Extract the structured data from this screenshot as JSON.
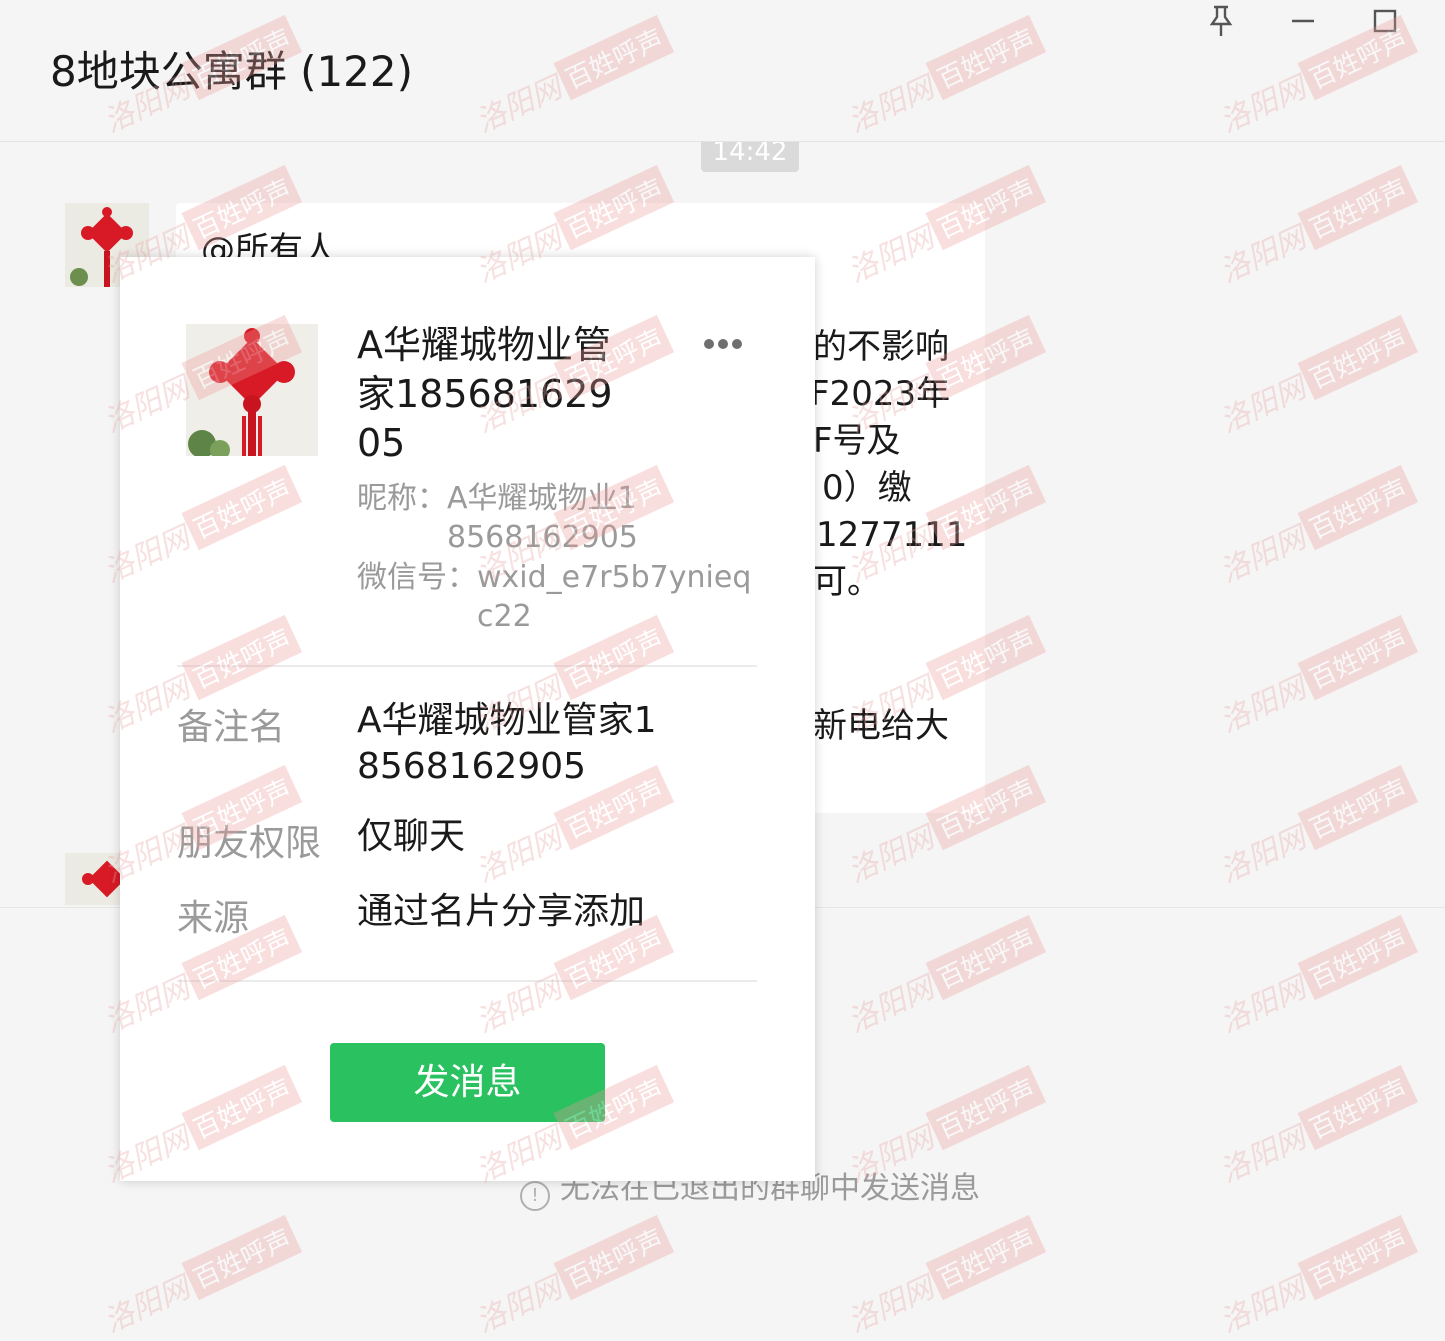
{
  "window": {
    "title": "8地块公寓群 (122)",
    "controls": {
      "pin": "pin-icon",
      "minimize": "minimize-icon",
      "maximize": "maximize-icon"
    }
  },
  "chat": {
    "time": "14:42",
    "message_lines": [
      "@所有人",
      "的不影响",
      "F2023年",
      "F号及",
      "0）缴",
      "1277111",
      "可。",
      "新电给大"
    ],
    "notice": "无法在已退出的群聊中发送消息"
  },
  "profile_card": {
    "name": "A华耀城物业管家18568162905",
    "nickname_label": "昵称：",
    "nickname": "A华耀城物业18568162905",
    "wechat_id_label": "微信号：",
    "wechat_id": "wxid_e7r5b7ynieqc22",
    "remark_label": "备注名",
    "remark": "A华耀城物业管家18568162905",
    "permission_label": "朋友权限",
    "permission": "仅聊天",
    "source_label": "来源",
    "source": "通过名片分享添加",
    "send_button": "发消息",
    "more_icon": "more-icon"
  },
  "watermark": {
    "script": "洛阳网",
    "boxed": "百姓呼声"
  },
  "colors": {
    "send_button": "#2ac161",
    "watermark": "#ee9a9a",
    "avatar_knot": "#d71a25"
  }
}
